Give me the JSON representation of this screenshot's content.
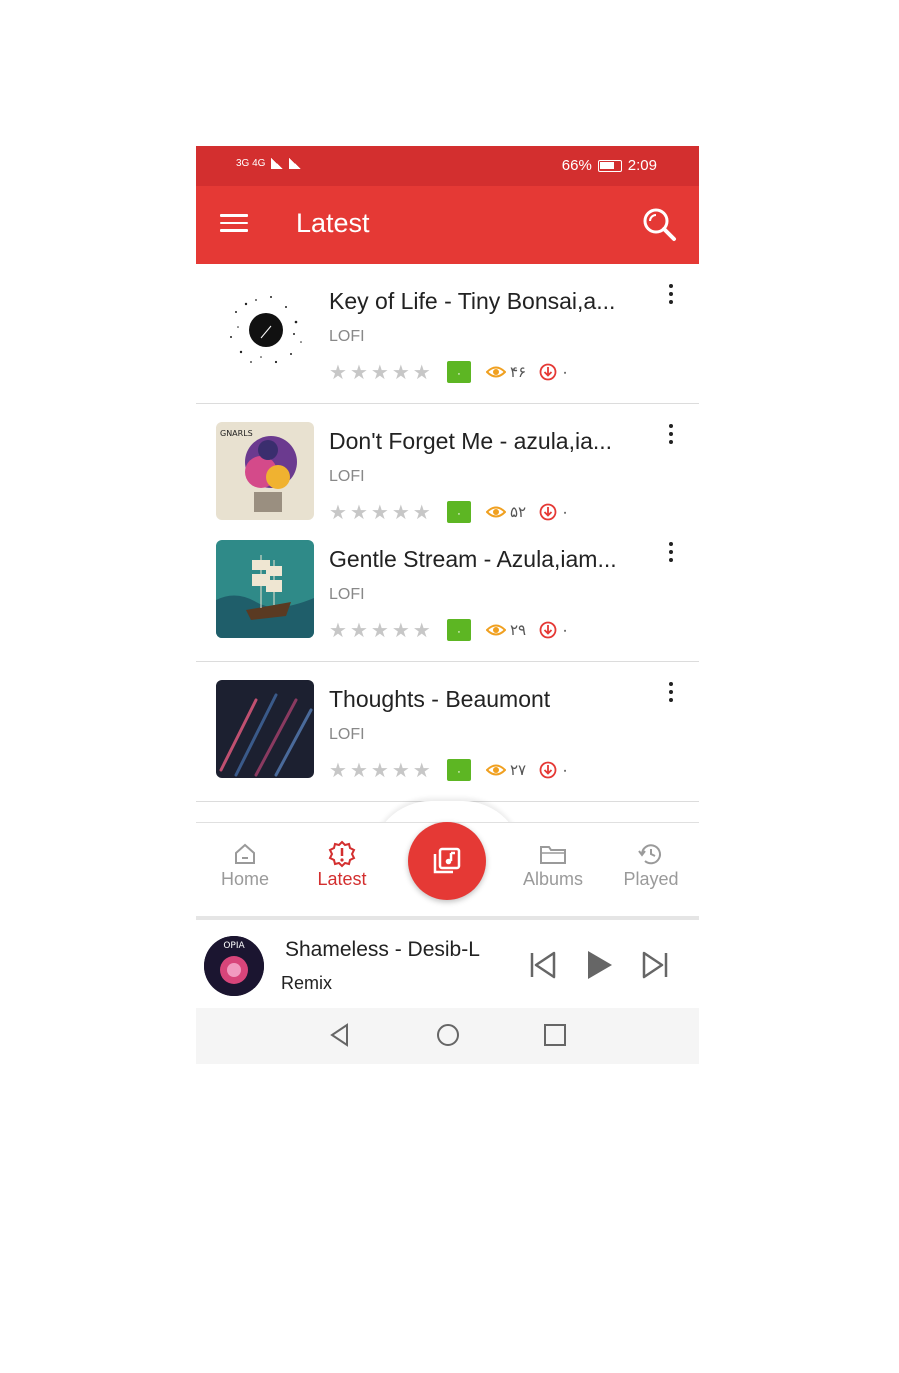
{
  "status_bar": {
    "network": "3G 4G",
    "battery": "66%",
    "time": "2:09"
  },
  "header": {
    "title": "Latest"
  },
  "tracks": [
    {
      "title": "Key of Life - Tiny Bonsai,a...",
      "category": "LOFI",
      "rating": 0,
      "badge": "۰",
      "views": "۴۶",
      "downloads": "۰"
    },
    {
      "title": "Don't Forget Me - azula,ia...",
      "category": "LOFI",
      "rating": 0,
      "badge": "۰",
      "views": "۵۲",
      "downloads": "۰"
    },
    {
      "title": "Gentle Stream - Azula,iam...",
      "category": "LOFI",
      "rating": 0,
      "badge": "۰",
      "views": "۲۹",
      "downloads": "۰"
    },
    {
      "title": "Thoughts - Beaumont",
      "category": "LOFI",
      "rating": 0,
      "badge": "۰",
      "views": "۲۷",
      "downloads": "۰"
    }
  ],
  "bottom_nav": {
    "items": [
      {
        "label": "Home",
        "icon": "home-icon"
      },
      {
        "label": "Latest",
        "icon": "alert-badge-icon",
        "active": true
      },
      {
        "label": "Albums",
        "icon": "folder-icon"
      },
      {
        "label": "Played",
        "icon": "history-icon"
      }
    ],
    "fab_icon": "music-library-icon"
  },
  "player": {
    "title": "Shameless - Desib-L",
    "subtitle": "Remix",
    "cover_text": "OPIA"
  },
  "colors": {
    "primary": "#e53935",
    "status_bar": "#d32f2f",
    "badge_green": "#5db623",
    "views_orange": "#f0a020",
    "download_red": "#e53935"
  }
}
